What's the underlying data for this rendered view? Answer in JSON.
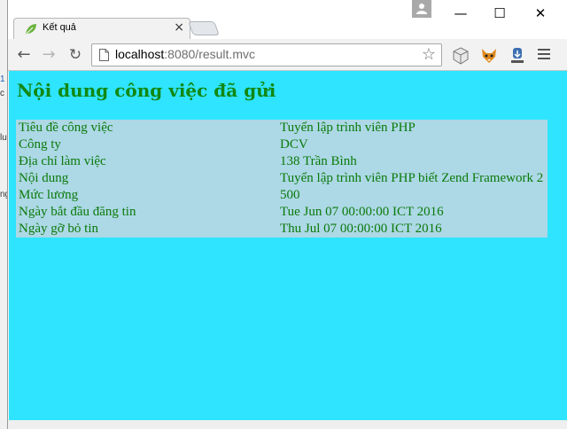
{
  "browser": {
    "tab_title": "Kết quả",
    "tab_close": "×",
    "url_host": "localhost",
    "url_rest": ":8080/result.mvc",
    "window_controls": {
      "minimize": "—",
      "maximize": "☐",
      "close": "✕"
    },
    "icons": [
      "leaf-icon",
      "back-arrow-icon",
      "forward-arrow-icon",
      "reload-icon",
      "page-icon",
      "star-icon",
      "cube-extension-icon",
      "fox-extension-icon",
      "download-extension-icon",
      "menu-icon",
      "profile-icon"
    ]
  },
  "background_fragments": [
    "1",
    "lu",
    "c",
    "ng"
  ],
  "page": {
    "title": "Nội dung công việc đã gửi",
    "rows": [
      {
        "label": "Tiêu đề công việc",
        "value": "Tuyển lập trình viên PHP"
      },
      {
        "label": "Công ty",
        "value": "DCV"
      },
      {
        "label": "Địa chỉ làm việc",
        "value": "138 Trần Bình"
      },
      {
        "label": "Nội dung",
        "value": "Tuyển lập trình viên PHP biết Zend Framework 2"
      },
      {
        "label": "Mức lương",
        "value": "500"
      },
      {
        "label": "Ngày bắt đầu đăng tin",
        "value": "Tue Jun 07 00:00:00 ICT 2016"
      },
      {
        "label": "Ngày gỡ bỏ tin",
        "value": "Thu Jul 07 00:00:00 ICT 2016"
      }
    ]
  },
  "colors": {
    "page_background": "#2ee4ff",
    "table_background": "#add8e6",
    "text_green": "#0a7a0a",
    "title_green": "#118811"
  }
}
